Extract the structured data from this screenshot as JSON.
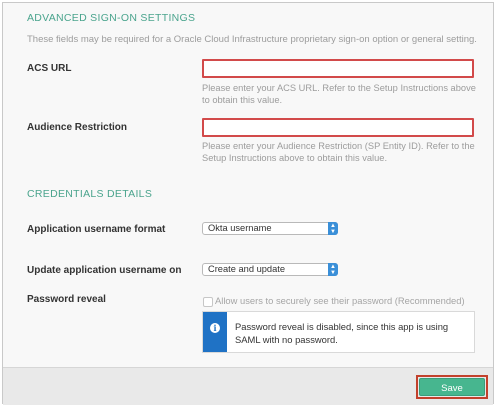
{
  "advanced": {
    "title": "ADVANCED SIGN-ON SETTINGS",
    "description": "These fields may be required for a Oracle Cloud Infrastructure proprietary sign-on option or general setting.",
    "acs_url": {
      "label": "ACS URL",
      "value": "",
      "hint": "Please enter your ACS URL. Refer to the Setup Instructions above to obtain this value."
    },
    "audience": {
      "label": "Audience Restriction",
      "value": "",
      "hint": "Please enter your Audience Restriction (SP Entity ID). Refer to the Setup Instructions above to obtain this value."
    }
  },
  "credentials": {
    "title": "CREDENTIALS DETAILS",
    "username_format": {
      "label": "Application username format",
      "selected": "Okta username"
    },
    "update_on": {
      "label": "Update application username on",
      "selected": "Create and update"
    },
    "password_reveal": {
      "label": "Password reveal",
      "checkbox_label": "Allow users to securely see their password (Recommended)",
      "checked": false,
      "info": "Password reveal is disabled, since this app is using SAML with no password."
    }
  },
  "footer": {
    "save_label": "Save"
  },
  "colors": {
    "accent": "#47b68f",
    "section_title": "#4aa48d",
    "error_border": "#d24a4a",
    "info_blue": "#1f72c5"
  },
  "icons": {
    "info": "info-icon",
    "select_arrow": "chevron-up-down-icon"
  }
}
